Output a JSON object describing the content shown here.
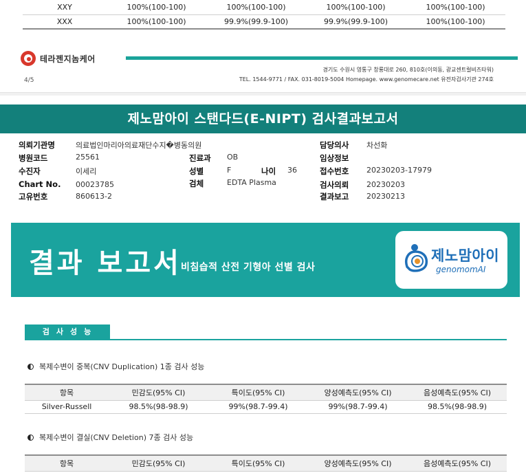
{
  "prev_table": {
    "rows": [
      [
        "XXY",
        "100%(100-100)",
        "100%(100-100)",
        "100%(100-100)",
        "100%(100-100)"
      ],
      [
        "XXX",
        "100%(100-100)",
        "99.9%(99.9-100)",
        "99.9%(99.9-100)",
        "100%(100-100)"
      ]
    ]
  },
  "footer": {
    "company": "테라젠지놈케어",
    "address_line1": "경기도 수원시 영통구 창룡대로 260, 810호(이의동, 광교센트럴비즈타워)",
    "address_line2": "TEL. 1544-9771 / FAX. 031-8019-5004 Homepage. www.genomecare.net 유전자검사기관 274호",
    "page": "4/5"
  },
  "report": {
    "title": "제노맘아이 스탠다드(E-NIPT) 검사결과보고서"
  },
  "patient": {
    "req_institution_label": "의뢰기관명",
    "req_institution": "의료법인마리아의료재단수지�병동의원",
    "hospital_code_label": "병원코드",
    "hospital_code": "25561",
    "patient_label": "수진자",
    "patient": "이세리",
    "chart_label": "Chart No.",
    "chart": "00023785",
    "unique_label": "고유번호",
    "unique": "860613-2",
    "dept_label": "진료과",
    "dept": "OB",
    "sex_label": "성별",
    "sex": "F",
    "age_label": "나이",
    "age": "36",
    "specimen_label": "검체",
    "specimen": "EDTA Plasma",
    "doctor_label": "담당의사",
    "doctor": "차선화",
    "clinical_label": "임상정보",
    "clinical": "",
    "reception_label": "접수번호",
    "reception": "20230203-17979",
    "request_label": "검사의뢰",
    "request": "20230203",
    "result_label": "결과보고",
    "result": "20230213"
  },
  "banner": {
    "title": "결과 보고서",
    "subtitle": "비침습적 산전 기형아 선별 검사",
    "logo_kor": "제노맘아이",
    "logo_eng": "genomomAI"
  },
  "section": {
    "tab": "검사성능"
  },
  "dup": {
    "heading": "복제수변이 중복(CNV Duplication) 1종 검사 성능",
    "headers": [
      "항목",
      "민감도(95% CI)",
      "특이도(95% CI)",
      "양성예측도(95% CI)",
      "음성예측도(95% CI)"
    ],
    "rows": [
      [
        "Silver-Russell",
        "98.5%(98-98.9)",
        "99%(98.7-99.4)",
        "99%(98.7-99.4)",
        "98.5%(98-98.9)"
      ]
    ]
  },
  "del": {
    "heading": "복제수변이 결실(CNV Deletion) 7종 검사 성능",
    "headers": [
      "항목",
      "민감도(95% CI)",
      "특이도(95% CI)",
      "양성예측도(95% CI)",
      "음성예측도(95% CI)"
    ]
  },
  "colors": {
    "teal_dark": "#13807b",
    "teal": "#1aa39e",
    "brand_blue": "#1f6fb8",
    "logo_red": "#d8382c"
  }
}
